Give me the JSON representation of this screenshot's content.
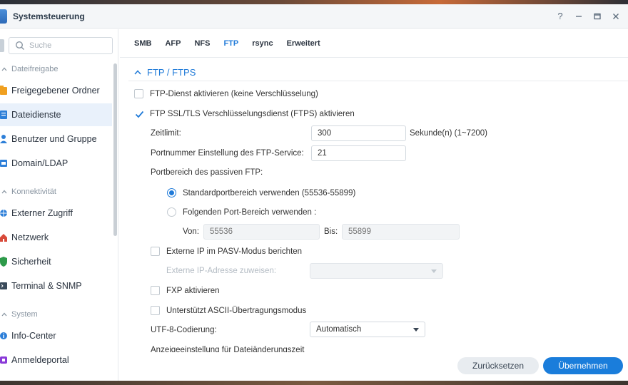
{
  "window": {
    "title": "Systemsteuerung",
    "help_label": "?"
  },
  "search": {
    "placeholder": "Suche"
  },
  "sidebar": {
    "sections": [
      {
        "label": "Dateifreigabe"
      },
      {
        "label": "Konnektivität"
      },
      {
        "label": "System"
      }
    ],
    "items": [
      {
        "label": "Freigegebener Ordner",
        "icon": "folder-share-icon",
        "color": "#f0a020"
      },
      {
        "label": "Dateidienste",
        "icon": "file-services-icon",
        "color": "#2d7fd8",
        "active": true
      },
      {
        "label": "Benutzer und Gruppe",
        "icon": "users-icon",
        "color": "#2d7fd8"
      },
      {
        "label": "Domain/LDAP",
        "icon": "domain-icon",
        "color": "#2d7fd8"
      },
      {
        "label": "Externer Zugriff",
        "icon": "globe-icon",
        "color": "#2d7fd8"
      },
      {
        "label": "Netzwerk",
        "icon": "home-network-icon",
        "color": "#d84a3a"
      },
      {
        "label": "Sicherheit",
        "icon": "shield-icon",
        "color": "#2d9a4a"
      },
      {
        "label": "Terminal & SNMP",
        "icon": "terminal-icon",
        "color": "#3a4a5a"
      },
      {
        "label": "Info-Center",
        "icon": "info-icon",
        "color": "#2d7fd8"
      },
      {
        "label": "Anmeldeportal",
        "icon": "portal-icon",
        "color": "#8a3ad8"
      }
    ]
  },
  "tabs": [
    {
      "label": "SMB"
    },
    {
      "label": "AFP"
    },
    {
      "label": "NFS"
    },
    {
      "label": "FTP",
      "active": true
    },
    {
      "label": "rsync"
    },
    {
      "label": "Erweitert"
    }
  ],
  "section": {
    "title": "FTP / FTPS"
  },
  "form": {
    "ftp_enable": {
      "label": "FTP-Dienst aktivieren (keine Verschlüsselung)",
      "checked": false
    },
    "ftps_enable": {
      "label": "FTP SSL/TLS Verschlüsselungsdienst (FTPS) aktivieren",
      "checked": true
    },
    "timeout": {
      "label": "Zeitlimit:",
      "value": "300",
      "unit": "Sekunde(n) (1~7200)"
    },
    "port": {
      "label": "Portnummer Einstellung des FTP-Service:",
      "value": "21"
    },
    "passive_range": {
      "label": "Portbereich des passiven FTP:"
    },
    "passive_default": {
      "label": "Standardportbereich verwenden (55536-55899)",
      "selected": true
    },
    "passive_custom": {
      "label": "Folgenden Port-Bereich verwenden :",
      "selected": false
    },
    "from": {
      "label": "Von:",
      "placeholder": "55536"
    },
    "to": {
      "label": "Bis:",
      "placeholder": "55899"
    },
    "external_ip": {
      "label": "Externe IP im PASV-Modus berichten",
      "checked": false
    },
    "external_ip_assign": {
      "label": "Externe IP-Adresse zuweisen:",
      "value": ""
    },
    "fxp": {
      "label": "FXP aktivieren",
      "checked": false
    },
    "ascii": {
      "label": "Unterstützt ASCII-Übertragungsmodus",
      "checked": false
    },
    "utf8": {
      "label": "UTF-8-Codierung:",
      "value": "Automatisch"
    },
    "display_setting": {
      "label": "Anzeigeeinstellung für Dateiänderungszeit"
    }
  },
  "footer": {
    "reset_label": "Zurücksetzen",
    "apply_label": "Übernehmen"
  },
  "colors": {
    "accent": "#1f7ad8",
    "apply_button": "#1a7ddb"
  }
}
